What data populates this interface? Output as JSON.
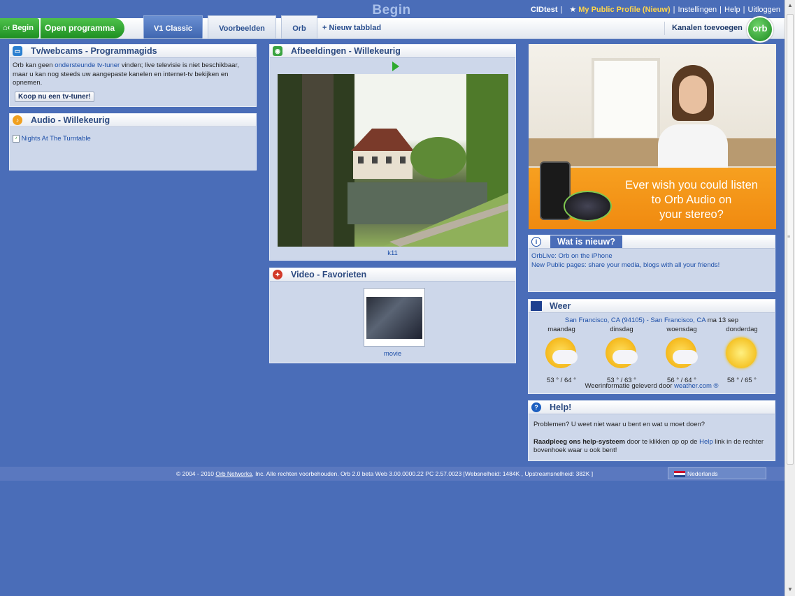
{
  "header": {
    "page_title": "Begin",
    "user": "CIDtest",
    "public_profile": "My Public Profile (Nieuw)",
    "settings": "Instellingen",
    "help": "Help",
    "logout": "Uitloggen"
  },
  "nav": {
    "begin": "Begin",
    "open_program": "Open programma",
    "tabs": [
      "V1 Classic",
      "Voorbeelden",
      "Orb"
    ],
    "new_tab": "+ Nieuw tabblad",
    "add_channels": "Kanalen toevoegen",
    "logo": "orb"
  },
  "tv": {
    "title": "Tv/webcams - Programmagids",
    "text_before": "Orb kan geen",
    "link": "ondersteunde tv-tuner",
    "text_after": "vinden; live televisie is niet beschikbaar, maar u kan nog steeds uw aangepaste kanelen en internet-tv bekijken en opnemen.",
    "button": "Koop nu een tv-tuner!"
  },
  "audio": {
    "title": "Audio - Willekeurig",
    "item": "Nights At The Turntable"
  },
  "images": {
    "title": "Afbeeldingen - Willekeurig",
    "caption": "k11"
  },
  "video": {
    "title": "Video - Favorieten",
    "caption": "movie"
  },
  "ad": {
    "line1": "Ever wish you could listen",
    "line2": "to Orb Audio on",
    "line3": "your stereo?"
  },
  "news": {
    "title": "Wat is nieuw?",
    "item1": "OrbLive: Orb on the iPhone",
    "item2": "New Public pages: share your media, blogs with all your friends!"
  },
  "weather": {
    "title": "Weer",
    "location": "San Francisco, CA (94105) - San Francisco, CA",
    "date": "ma 13 sep",
    "days": [
      {
        "name": "maandag",
        "temp": "53 ° / 64 °"
      },
      {
        "name": "dinsdag",
        "temp": "53 ° / 63 °"
      },
      {
        "name": "woensdag",
        "temp": "56 ° / 64 °"
      },
      {
        "name": "donderdag",
        "temp": "58 ° / 65 °"
      }
    ],
    "credit_text": "Weerinformatie geleverd door",
    "credit_link": "weather.com ®"
  },
  "help": {
    "title": "Help!",
    "line1": "Problemen? U weet niet waar u bent en wat u moet doen?",
    "line2_bold": "Raadpleeg ons help-systeem",
    "line2_mid": "door te klikken op op de",
    "line2_link": "Help",
    "line2_end": "link in de rechter bovenhoek waar u ook bent!"
  },
  "footer": {
    "copyright": "© 2004 - 2010",
    "company": "Orb Networks",
    "rest": ", Inc. Alle rechten voorbehouden. Orb 2.0 beta  Web 3.00.0000.22  PC 2.57.0023  [Websnelheid:  1484K  , Upstreamsnelheid:  382K  ]",
    "language": "Nederlands"
  }
}
